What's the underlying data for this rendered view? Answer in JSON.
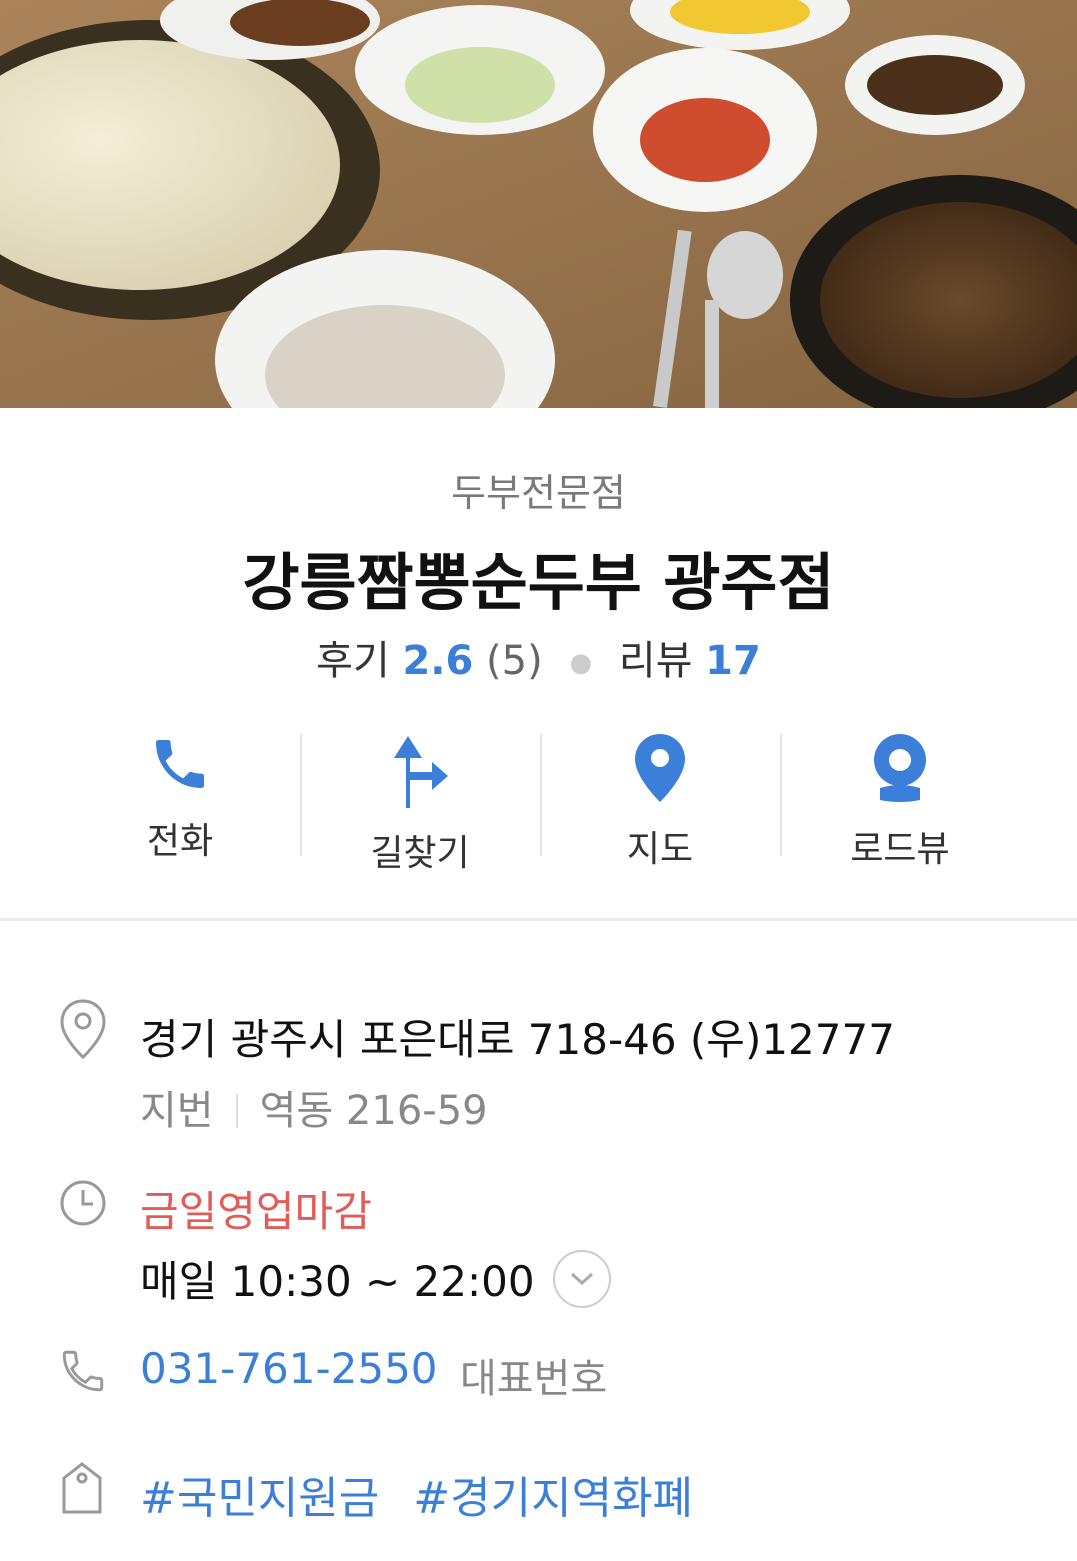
{
  "store": {
    "category": "두부전문점",
    "name": "강릉짬뽕순두부 광주점"
  },
  "ratings": {
    "review_label": "후기",
    "review_score": "2.6",
    "review_count": "(5)",
    "blog_label": "리뷰",
    "blog_count": "17"
  },
  "actions": [
    {
      "label": "전화",
      "icon": "phone-icon"
    },
    {
      "label": "길찾기",
      "icon": "directions-icon"
    },
    {
      "label": "지도",
      "icon": "map-pin-icon"
    },
    {
      "label": "로드뷰",
      "icon": "roadview-icon"
    }
  ],
  "info": {
    "address": "경기 광주시 포은대로 718-46 (우)12777",
    "jibun_label": "지번",
    "jibun_value": "역동 216-59",
    "status": "금일영업마감",
    "hours": "매일 10:30 ~ 22:00",
    "phone": "031-761-2550",
    "phone_label": "대표번호",
    "tags": [
      "#국민지원금",
      "#경기지역화폐"
    ]
  },
  "colors": {
    "accent_blue": "#3b7fd9",
    "status_red": "#e25c57"
  }
}
